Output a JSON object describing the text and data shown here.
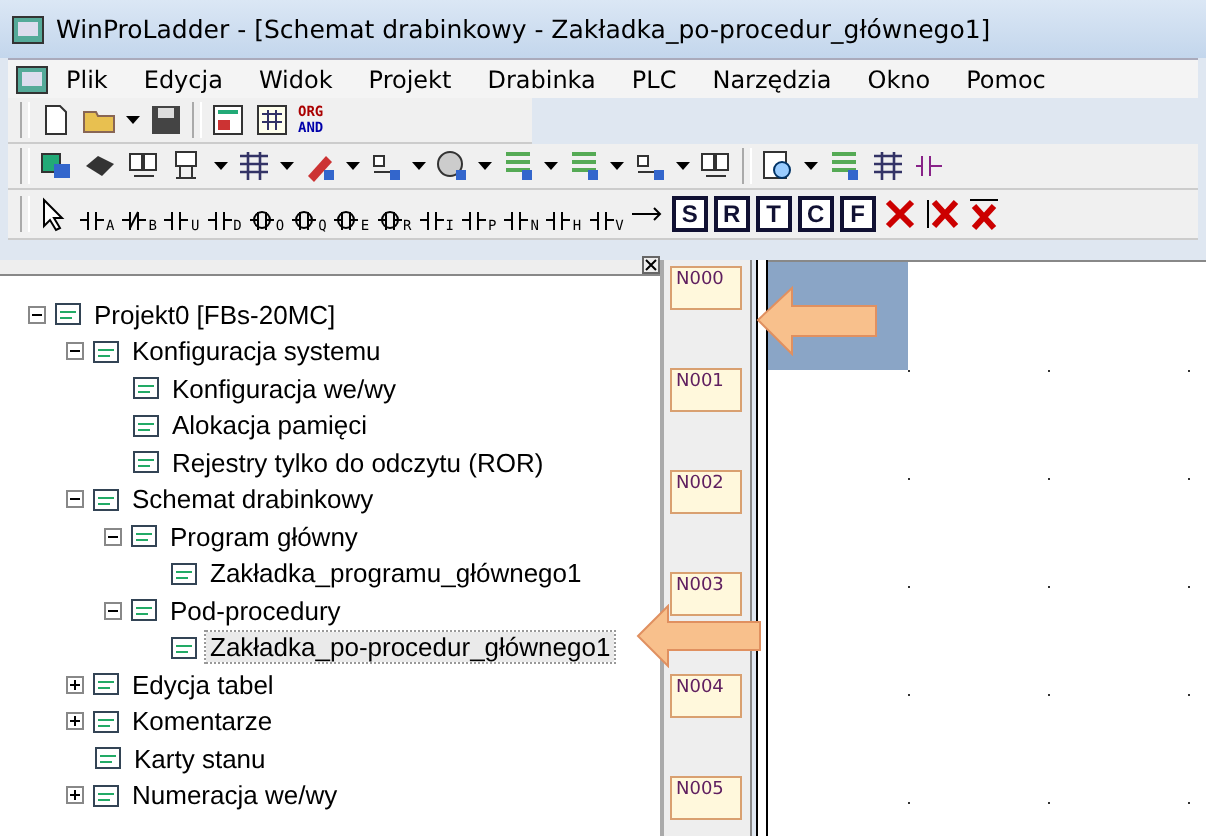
{
  "window": {
    "title": "WinProLadder - [Schemat drabinkowy - Zakładka_po-procedur_głównego1]"
  },
  "menu": [
    "Plik",
    "Edycja",
    "Widok",
    "Projekt",
    "Drabinka",
    "PLC",
    "Narzędzia",
    "Okno",
    "Pomoc"
  ],
  "toolbar_text_button": {
    "lines": [
      "ORG",
      "AND"
    ]
  },
  "ladder_tools": [
    {
      "sub": "A"
    },
    {
      "sub": "B"
    },
    {
      "sub": "U"
    },
    {
      "sub": "D"
    },
    {
      "sub": "O"
    },
    {
      "sub": "Q"
    },
    {
      "sub": "E"
    },
    {
      "sub": "R"
    },
    {
      "sub": "I"
    },
    {
      "sub": "P"
    },
    {
      "sub": "N"
    },
    {
      "sub": "H"
    },
    {
      "sub": "V"
    }
  ],
  "instruction_buttons": [
    "S",
    "R",
    "T",
    "C",
    "F"
  ],
  "tree": [
    {
      "label": "Projekt0 [FBs-20MC]",
      "expanded": true,
      "selected": false,
      "children": [
        {
          "label": "Konfiguracja systemu",
          "expanded": true,
          "selected": false,
          "children": [
            {
              "label": "Konfiguracja we/wy",
              "selected": false
            },
            {
              "label": "Alokacja pamięci",
              "selected": false
            },
            {
              "label": "Rejestry tylko do odczytu (ROR)",
              "selected": false
            }
          ]
        },
        {
          "label": "Schemat drabinkowy",
          "expanded": true,
          "selected": false,
          "children": [
            {
              "label": "Program główny",
              "expanded": true,
              "selected": false,
              "children": [
                {
                  "label": "Zakładka_programu_głównego1",
                  "selected": false
                }
              ]
            },
            {
              "label": "Pod-procedury",
              "expanded": true,
              "selected": false,
              "children": [
                {
                  "label": "Zakładka_po-procedur_głównego1",
                  "selected": true
                }
              ]
            }
          ]
        },
        {
          "label": "Edycja tabel",
          "expanded": false,
          "selected": false
        },
        {
          "label": "Komentarze",
          "expanded": false,
          "selected": false
        },
        {
          "label": "Karty stanu",
          "selected": false
        },
        {
          "label": "Numeracja we/wy",
          "expanded": false,
          "selected": false
        }
      ]
    }
  ],
  "rungs": [
    {
      "label": "N000",
      "cursor": true
    },
    {
      "label": "N001",
      "cursor": false
    },
    {
      "label": "N002",
      "cursor": false
    },
    {
      "label": "N003",
      "cursor": false
    },
    {
      "label": "N004",
      "cursor": false
    },
    {
      "label": "N005",
      "cursor": false
    }
  ]
}
